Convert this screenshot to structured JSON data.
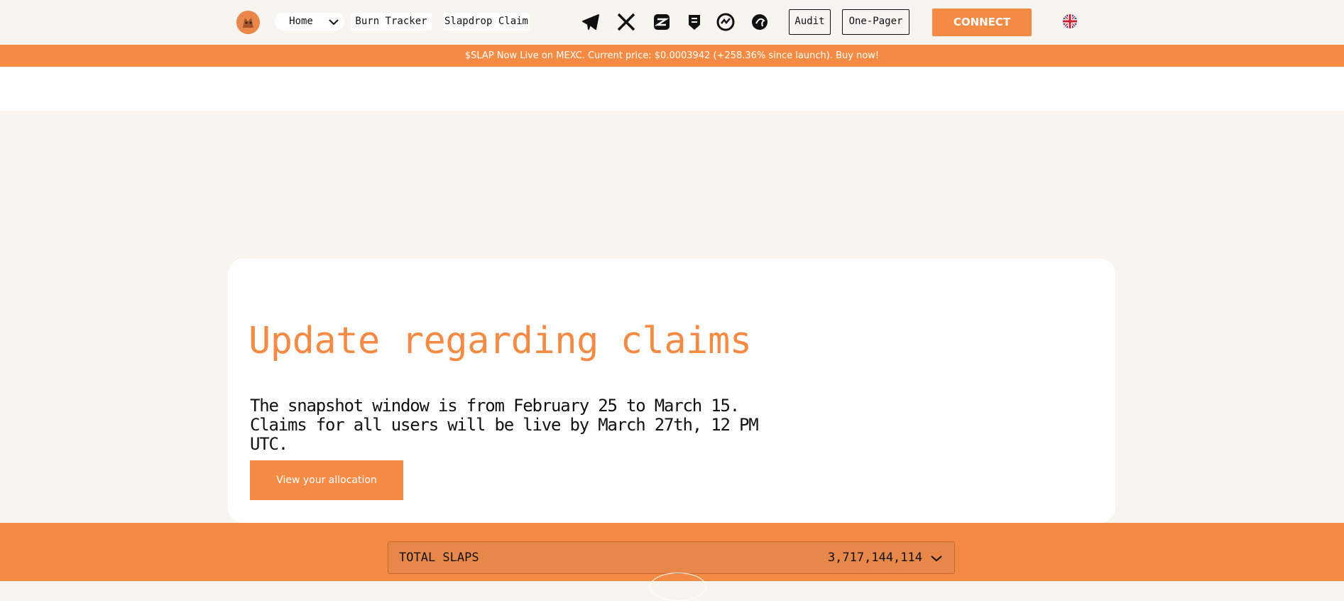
{
  "nav": {
    "home_label": "Home",
    "burn_tracker_label": "Burn Tracker",
    "slapdrop_claim_label": "Slapdrop Claim",
    "audit_label": "Audit",
    "one_pager_label": "One-Pager",
    "connect_label": "CONNECT",
    "social_icons": [
      "telegram-icon",
      "x-icon",
      "coinmarketcap-icon",
      "certik-icon",
      "coingecko-style-icon",
      "dragon-icon"
    ]
  },
  "banner": {
    "text": "$SLAP Now Live on MEXC. Current price: $0.0003942 (+258.36% since launch). Buy now!"
  },
  "card": {
    "title": "Update regarding claims",
    "body": "The snapshot window is from February 25 to March 15. Claims for all users will be live by March 27th, 12 PM UTC.",
    "button_label": "View your allocation"
  },
  "total": {
    "label": "TOTAL SLAPS",
    "value": "3,717,144,114"
  },
  "colors": {
    "accent": "#f38b45",
    "background": "#f8f4ef"
  }
}
